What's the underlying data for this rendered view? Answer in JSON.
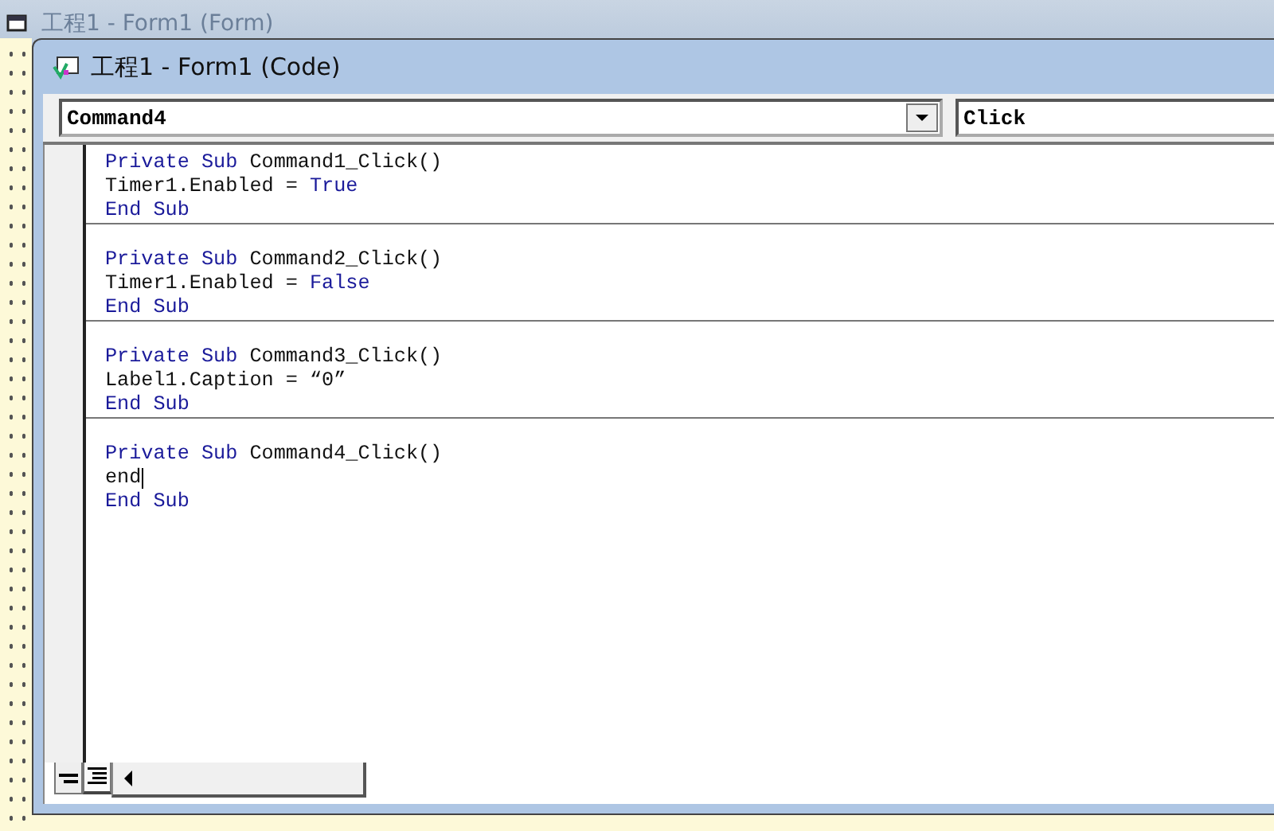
{
  "parent_window": {
    "title": "工程1 - Form1 (Form)"
  },
  "code_window": {
    "title": "工程1 - Form1 (Code)"
  },
  "object_combo": {
    "value": "Command4"
  },
  "procedure_combo": {
    "value": "Click"
  },
  "procedures": [
    {
      "lines": [
        [
          {
            "text": "Private Sub",
            "keyword": true
          },
          {
            "text": " Command1_Click()",
            "keyword": false
          }
        ],
        [
          {
            "text": "Timer1.Enabled = ",
            "keyword": false
          },
          {
            "text": "True",
            "keyword": true
          }
        ],
        [
          {
            "text": "End Sub",
            "keyword": true
          }
        ]
      ]
    },
    {
      "lines": [
        [
          {
            "text": "Private Sub",
            "keyword": true
          },
          {
            "text": " Command2_Click()",
            "keyword": false
          }
        ],
        [
          {
            "text": "Timer1.Enabled = ",
            "keyword": false
          },
          {
            "text": "False",
            "keyword": true
          }
        ],
        [
          {
            "text": "End Sub",
            "keyword": true
          }
        ]
      ]
    },
    {
      "lines": [
        [
          {
            "text": "Private Sub",
            "keyword": true
          },
          {
            "text": " Command3_Click()",
            "keyword": false
          }
        ],
        [
          {
            "text": "Label1.Caption = “0”",
            "keyword": false
          }
        ],
        [
          {
            "text": "End Sub",
            "keyword": true
          }
        ]
      ]
    },
    {
      "lines": [
        [
          {
            "text": "Private Sub",
            "keyword": true
          },
          {
            "text": " Command4_Click()",
            "keyword": false
          }
        ],
        [
          {
            "text": "end",
            "keyword": false
          }
        ],
        [
          {
            "text": "End Sub",
            "keyword": true
          }
        ]
      ]
    }
  ]
}
